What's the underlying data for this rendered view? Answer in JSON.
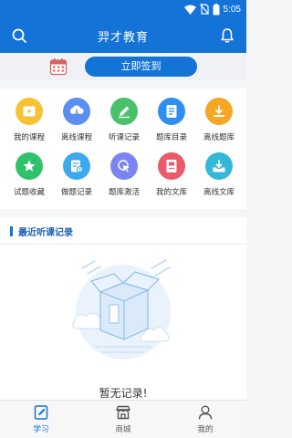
{
  "status_bar": {
    "time": "5:05"
  },
  "app_bar": {
    "title": "羿才教育"
  },
  "checkin": {
    "button_label": "立即签到"
  },
  "grid": {
    "items": [
      {
        "label": "我的课程",
        "icon": "play-icon",
        "color": "#f6c233"
      },
      {
        "label": "离线课程",
        "icon": "cloud-download-icon",
        "color": "#5a8ef0"
      },
      {
        "label": "听课记录",
        "icon": "pencil-icon",
        "color": "#49c06a"
      },
      {
        "label": "题库目录",
        "icon": "document-icon",
        "color": "#2e8ff0"
      },
      {
        "label": "离线题库",
        "icon": "download-icon",
        "color": "#f5a623"
      },
      {
        "label": "试题收藏",
        "icon": "star-icon",
        "color": "#2fc26b"
      },
      {
        "label": "做题记录",
        "icon": "record-icon",
        "color": "#3aa9ee"
      },
      {
        "label": "题库激活",
        "icon": "cursor-icon",
        "color": "#7a84f2"
      },
      {
        "label": "我的文库",
        "icon": "book-icon",
        "color": "#ea5a6a"
      },
      {
        "label": "离线文库",
        "icon": "tray-download-icon",
        "color": "#35b8d8"
      }
    ]
  },
  "section": {
    "title": "最近听课记录"
  },
  "empty_state": {
    "text": "暂无记录!"
  },
  "tab_bar": {
    "tabs": [
      {
        "label": "学习",
        "icon": "study-icon",
        "active": true
      },
      {
        "label": "商城",
        "icon": "store-icon",
        "active": false
      },
      {
        "label": "我的",
        "icon": "person-icon",
        "active": false
      }
    ]
  },
  "colors": {
    "primary": "#1473d6"
  }
}
